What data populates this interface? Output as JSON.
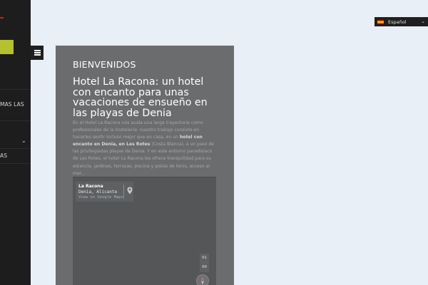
{
  "sidebar": {
    "items": [
      {
        "label": "MAS LAS"
      },
      {
        "label": "AS"
      }
    ],
    "chevron_icon": "chevron-down-icon",
    "accent_red": "#c0271c",
    "accent_lime": "#b5c12e"
  },
  "menu_toggle": {
    "icon": "hamburger-icon"
  },
  "language": {
    "label": "Español",
    "flag_icon": "spain-flag-icon",
    "caret_icon": "caret-down-icon"
  },
  "content": {
    "kicker": "BIENVENIDOS",
    "title": "Hotel La Racona: un hotel con encanto para unas vacaciones de ensueño en las playas de Denia",
    "intro_part1": "En el Hotel La Racona nos avala una larga trayectoria como profesionales de la hostelería: nuestro trabajo consiste en hacerles sentir incluso mejor que en casa, en un ",
    "intro_bold1": "hotel con encanto en Denia, en Les Rotes",
    "intro_part2": " (Costa Blanca), a un paso de las privilegiadas playas de Denia. Y en este entorno paradisíaco de Les Rotes, el hotel La Racona les ofrece tranquilidad para su estancia, jardines, terrazas, piscina y pistas de tenis, acceso al mar..."
  },
  "map": {
    "place_name": "La Racona",
    "address": "Denia, Alicante",
    "link_label": "View on Google Maps",
    "zoom_in_label": "01",
    "zoom_out_label": "00",
    "pin_icon": "map-pin-icon",
    "compass_icon": "compass-icon"
  }
}
